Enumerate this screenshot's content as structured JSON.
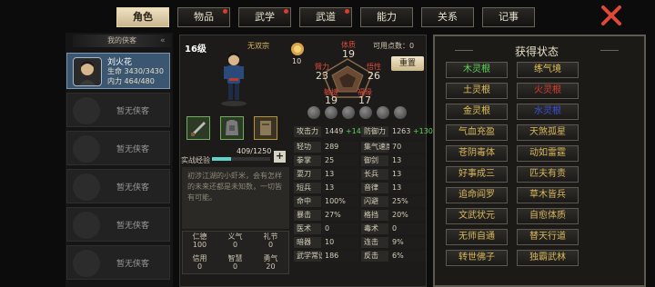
{
  "tabs": [
    {
      "label": "角色",
      "active": true,
      "dot": false
    },
    {
      "label": "物品",
      "active": false,
      "dot": true
    },
    {
      "label": "武学",
      "active": false,
      "dot": true
    },
    {
      "label": "武道",
      "active": false,
      "dot": true
    },
    {
      "label": "能力",
      "active": false,
      "dot": false
    },
    {
      "label": "关系",
      "active": false,
      "dot": false
    },
    {
      "label": "记事",
      "active": false,
      "dot": false
    }
  ],
  "sidebar": {
    "title": "我的侠客",
    "hero": {
      "name": "刘火花",
      "hp_label": "生命",
      "hp": "3430/3430",
      "mp_label": "内力",
      "mp": "464/480"
    },
    "empty_label": "暂无侠客"
  },
  "char": {
    "level": "16级",
    "sect": "无双宗",
    "points_label": "可用点数：",
    "points": "0",
    "coin": "10",
    "reset": "重置",
    "attrs": {
      "constitution_label": "体质",
      "constitution": "19",
      "strength_label": "臂力",
      "strength": "23",
      "insight_label": "悟性",
      "insight": "26",
      "agility_label": "敏捷",
      "agility": "19",
      "luck_label": "福缘",
      "luck": "17"
    },
    "exp_label": "实战经验",
    "exp": "409/1250",
    "exp_fraction": 0.327,
    "bio": "初涉江湖的小虾米，会有怎样的未来还都是未知数，一切皆有可能。",
    "virtues": [
      {
        "label": "仁德",
        "value": "100"
      },
      {
        "label": "义气",
        "value": "0"
      },
      {
        "label": "礼节",
        "value": "0"
      },
      {
        "label": "信用",
        "value": "0"
      },
      {
        "label": "智慧",
        "value": "0"
      },
      {
        "label": "勇气",
        "value": "20"
      }
    ]
  },
  "stats": {
    "attack_label": "攻击力",
    "attack": "1449",
    "attack_bonus": "+144",
    "defense_label": "防御力",
    "defense": "1263",
    "defense_bonus": "+130",
    "left": [
      {
        "label": "轻功",
        "value": "289"
      },
      {
        "label": "拳掌",
        "value": "25"
      },
      {
        "label": "耍刀",
        "value": "13"
      },
      {
        "label": "短兵",
        "value": "13"
      },
      {
        "label": "命中",
        "value": "100%"
      },
      {
        "label": "暴击",
        "value": "27%"
      },
      {
        "label": "医术",
        "value": "0"
      },
      {
        "label": "暗器",
        "value": "10"
      },
      {
        "label": "武学常识",
        "value": "186"
      }
    ],
    "right": [
      {
        "label": "集气速度",
        "value": "70"
      },
      {
        "label": "御剑",
        "value": "13"
      },
      {
        "label": "长兵",
        "value": "13"
      },
      {
        "label": "音律",
        "value": "13"
      },
      {
        "label": "闪避",
        "value": "25%"
      },
      {
        "label": "格挡",
        "value": "20%"
      },
      {
        "label": "毒术",
        "value": "0"
      },
      {
        "label": "连击",
        "value": "9%"
      },
      {
        "label": "反击",
        "value": "6%"
      }
    ]
  },
  "status": {
    "title": "获得状态",
    "items": [
      {
        "label": "木灵根",
        "color": "#5fd35a"
      },
      {
        "label": "练气境",
        "color": "#e6c35a"
      },
      {
        "label": "土灵根",
        "color": "#e6c35a"
      },
      {
        "label": "火灵根",
        "color": "#e03a2a"
      },
      {
        "label": "金灵根",
        "color": "#e6c35a"
      },
      {
        "label": "水灵根",
        "color": "#3a4fd6"
      },
      {
        "label": "气血充盈",
        "color": "#d9b75a"
      },
      {
        "label": "天煞孤星",
        "color": "#d9b75a"
      },
      {
        "label": "苍阴毒体",
        "color": "#d9b75a"
      },
      {
        "label": "动如雷霆",
        "color": "#d9b75a"
      },
      {
        "label": "好事成三",
        "color": "#d9b75a"
      },
      {
        "label": "匹夫有责",
        "color": "#d9b75a"
      },
      {
        "label": "追命阎罗",
        "color": "#d9b75a"
      },
      {
        "label": "草木皆兵",
        "color": "#d9b75a"
      },
      {
        "label": "文武状元",
        "color": "#d9b75a"
      },
      {
        "label": "自愈体质",
        "color": "#d9b75a"
      },
      {
        "label": "无师自通",
        "color": "#d9b75a"
      },
      {
        "label": "替天行道",
        "color": "#d9b75a"
      },
      {
        "label": "转世佛子",
        "color": "#d9b75a"
      },
      {
        "label": "独霸武林",
        "color": "#d9b75a"
      }
    ]
  },
  "colors": {
    "accent": "#e6d4a8",
    "hero_bg": "#3a5670",
    "bonus": "#5fd35a",
    "exp_bar": "#5fd3c8"
  }
}
